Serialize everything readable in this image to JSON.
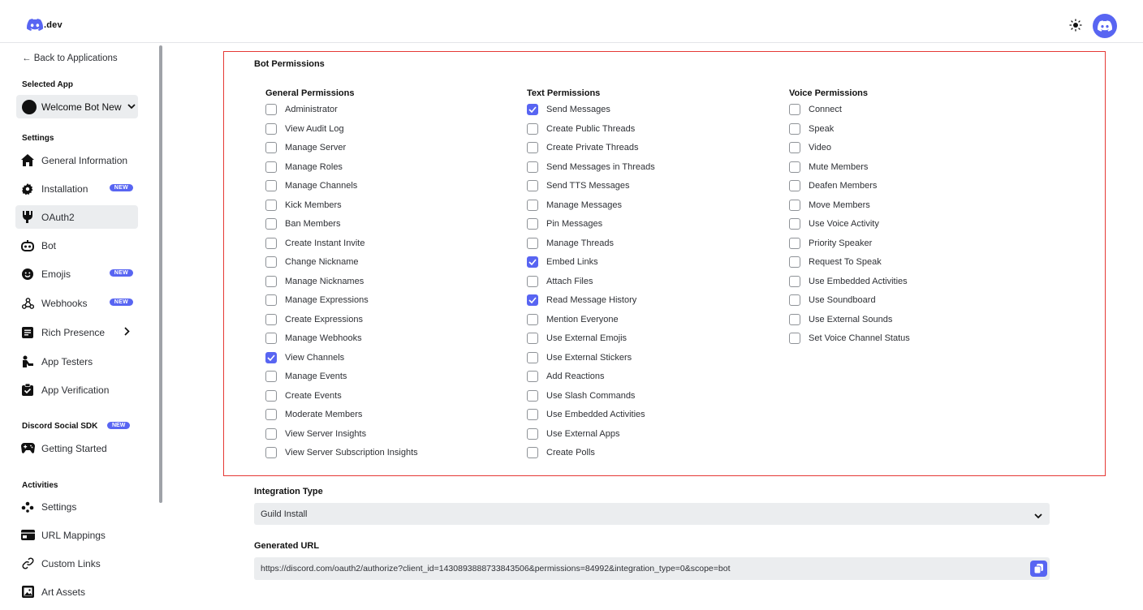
{
  "header": {
    "logo_text": ".dev"
  },
  "sidebar": {
    "back_label": "← Back to Applications",
    "selected_app_label": "Selected App",
    "selected_app_name": "Welcome Bot New",
    "settings_label": "Settings",
    "items": [
      {
        "label": "General Information",
        "icon": "home-icon"
      },
      {
        "label": "Installation",
        "icon": "gear-icon",
        "badge": "NEW"
      },
      {
        "label": "OAuth2",
        "icon": "wrench-icon",
        "active": true
      },
      {
        "label": "Bot",
        "icon": "bot-icon"
      },
      {
        "label": "Emojis",
        "icon": "smiley-icon",
        "badge": "NEW"
      },
      {
        "label": "Webhooks",
        "icon": "webhook-icon",
        "badge": "NEW"
      },
      {
        "label": "Rich Presence",
        "icon": "document-icon"
      },
      {
        "label": "App Testers",
        "icon": "person-icon"
      },
      {
        "label": "App Verification",
        "icon": "clipboard-check-icon"
      }
    ],
    "sdk_label": "Discord Social SDK",
    "sdk_badge": "NEW",
    "sdk_items": [
      {
        "label": "Getting Started",
        "icon": "gamepad-icon"
      }
    ],
    "activities_label": "Activities",
    "activity_items": [
      {
        "label": "Settings",
        "icon": "dots-icon"
      },
      {
        "label": "URL Mappings",
        "icon": "url-icon"
      },
      {
        "label": "Custom Links",
        "icon": "link-icon"
      },
      {
        "label": "Art Assets",
        "icon": "image-icon"
      }
    ]
  },
  "permissions": {
    "title": "Bot Permissions",
    "columns": [
      {
        "heading": "General Permissions",
        "items": [
          {
            "label": "Administrator",
            "checked": false
          },
          {
            "label": "View Audit Log",
            "checked": false
          },
          {
            "label": "Manage Server",
            "checked": false
          },
          {
            "label": "Manage Roles",
            "checked": false
          },
          {
            "label": "Manage Channels",
            "checked": false
          },
          {
            "label": "Kick Members",
            "checked": false
          },
          {
            "label": "Ban Members",
            "checked": false
          },
          {
            "label": "Create Instant Invite",
            "checked": false
          },
          {
            "label": "Change Nickname",
            "checked": false
          },
          {
            "label": "Manage Nicknames",
            "checked": false
          },
          {
            "label": "Manage Expressions",
            "checked": false
          },
          {
            "label": "Create Expressions",
            "checked": false
          },
          {
            "label": "Manage Webhooks",
            "checked": false
          },
          {
            "label": "View Channels",
            "checked": true
          },
          {
            "label": "Manage Events",
            "checked": false
          },
          {
            "label": "Create Events",
            "checked": false
          },
          {
            "label": "Moderate Members",
            "checked": false
          },
          {
            "label": "View Server Insights",
            "checked": false
          },
          {
            "label": "View Server Subscription Insights",
            "checked": false
          }
        ]
      },
      {
        "heading": "Text Permissions",
        "items": [
          {
            "label": "Send Messages",
            "checked": true
          },
          {
            "label": "Create Public Threads",
            "checked": false
          },
          {
            "label": "Create Private Threads",
            "checked": false
          },
          {
            "label": "Send Messages in Threads",
            "checked": false
          },
          {
            "label": "Send TTS Messages",
            "checked": false
          },
          {
            "label": "Manage Messages",
            "checked": false
          },
          {
            "label": "Pin Messages",
            "checked": false
          },
          {
            "label": "Manage Threads",
            "checked": false
          },
          {
            "label": "Embed Links",
            "checked": true
          },
          {
            "label": "Attach Files",
            "checked": false
          },
          {
            "label": "Read Message History",
            "checked": true
          },
          {
            "label": "Mention Everyone",
            "checked": false
          },
          {
            "label": "Use External Emojis",
            "checked": false
          },
          {
            "label": "Use External Stickers",
            "checked": false
          },
          {
            "label": "Add Reactions",
            "checked": false
          },
          {
            "label": "Use Slash Commands",
            "checked": false
          },
          {
            "label": "Use Embedded Activities",
            "checked": false
          },
          {
            "label": "Use External Apps",
            "checked": false
          },
          {
            "label": "Create Polls",
            "checked": false
          }
        ]
      },
      {
        "heading": "Voice Permissions",
        "items": [
          {
            "label": "Connect",
            "checked": false
          },
          {
            "label": "Speak",
            "checked": false
          },
          {
            "label": "Video",
            "checked": false
          },
          {
            "label": "Mute Members",
            "checked": false
          },
          {
            "label": "Deafen Members",
            "checked": false
          },
          {
            "label": "Move Members",
            "checked": false
          },
          {
            "label": "Use Voice Activity",
            "checked": false
          },
          {
            "label": "Priority Speaker",
            "checked": false
          },
          {
            "label": "Request To Speak",
            "checked": false
          },
          {
            "label": "Use Embedded Activities",
            "checked": false
          },
          {
            "label": "Use Soundboard",
            "checked": false
          },
          {
            "label": "Use External Sounds",
            "checked": false
          },
          {
            "label": "Set Voice Channel Status",
            "checked": false
          }
        ]
      }
    ]
  },
  "integration": {
    "label": "Integration Type",
    "value": "Guild Install"
  },
  "generated_url": {
    "label": "Generated URL",
    "value": "https://discord.com/oauth2/authorize?client_id=1430893888733843506&permissions=84992&integration_type=0&scope=bot"
  },
  "colors": {
    "accent": "#5865f2",
    "highlight_border": "#e53935"
  }
}
